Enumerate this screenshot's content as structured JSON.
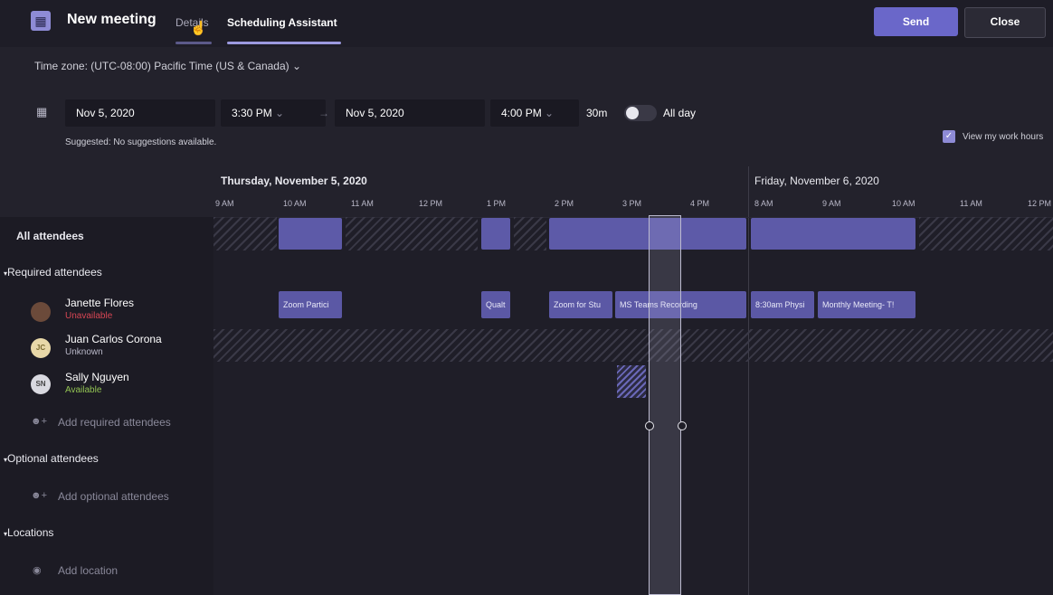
{
  "header": {
    "title": "New meeting",
    "tabs": [
      {
        "label": "Details"
      },
      {
        "label": "Scheduling Assistant"
      }
    ],
    "send_label": "Send",
    "close_label": "Close"
  },
  "timezone": "Time zone: (UTC-08:00) Pacific Time (US & Canada)",
  "form": {
    "start_date": "Nov 5, 2020",
    "start_time": "3:30 PM",
    "end_date": "Nov 5, 2020",
    "end_time": "4:00 PM",
    "duration": "30m",
    "all_day": "All day",
    "suggested": "Suggested: No suggestions available.",
    "view_work_hours": "View my work hours"
  },
  "sidebar": {
    "all_attendees": "All attendees",
    "required_header": "Required attendees",
    "people": [
      {
        "name": "Janette Flores",
        "status": "Unavailable",
        "initials": "",
        "status_color": "#d74654"
      },
      {
        "name": "Juan Carlos Corona",
        "status": "Unknown",
        "initials": "JC",
        "status_color": "#b9b8c8"
      },
      {
        "name": "Sally Nguyen",
        "status": "Available",
        "initials": "SN",
        "status_color": "#92c353"
      }
    ],
    "add_required": "Add required attendees",
    "optional_header": "Optional attendees",
    "add_optional": "Add optional attendees",
    "locations_header": "Locations",
    "add_location": "Add location"
  },
  "grid": {
    "day1": "Thursday, November 5, 2020",
    "day2": "Friday, November 6, 2020",
    "hours": [
      "9 AM",
      "10 AM",
      "11 AM",
      "12 PM",
      "1 PM",
      "2 PM",
      "3 PM",
      "4 PM",
      "8 AM",
      "9 AM",
      "10 AM",
      "11 AM",
      "12 PM"
    ],
    "events": [
      "Zoom Partici",
      "Qualt",
      "Zoom for Stu",
      "MS Teams Recording",
      "8:30am Physi",
      "Monthly Meeting- T!"
    ]
  },
  "colors": {
    "accent": "#6a67c9",
    "busy": "#5d5aa8"
  }
}
